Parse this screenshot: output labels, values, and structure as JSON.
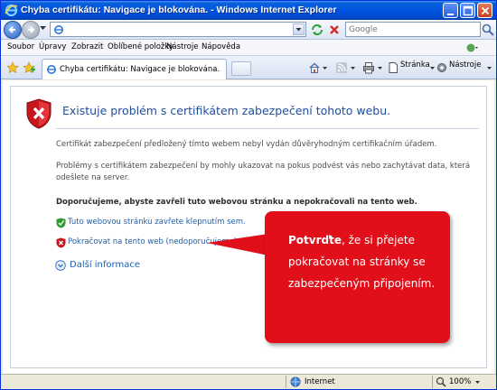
{
  "window": {
    "title": "Chyba certifikátu: Navigace je blokována. - Windows Internet Explorer"
  },
  "addressbar": {
    "url": "",
    "search_placeholder": "Google"
  },
  "menu": {
    "items": [
      "Soubor",
      "Úpravy",
      "Zobrazit",
      "Oblíbené položky",
      "Nástroje",
      "Nápověda"
    ]
  },
  "tabbar": {
    "tab_title": "Chyba certifikátu: Navigace je blokována.",
    "page_label": "Stránka",
    "tools_label": "Nástroje"
  },
  "page": {
    "heading": "Existuje problém s certifikátem zabezpečení tohoto webu.",
    "para1": "Certifikát zabezpečení předložený tímto webem nebyl vydán důvěryhodným certifikačním úřadem.",
    "para2": "Problémy s certifikátem zabezpečení by mohly ukazovat na pokus podvést vás nebo zachytávat data, která odešlete na server.",
    "recommend": "Doporučujeme, abyste zavřeli tuto webovou stránku a nepokračovali na tento web.",
    "link_close": "Tuto webovou stránku zavřete klepnutím sem.",
    "link_continue": "Pokračovat na tento web (nedoporučujeme)",
    "more_info": "Další informace"
  },
  "callout": {
    "bold": "Potvrďte",
    "text": ", že si přejete pokračovat na stránky se zabezpečeným připojením."
  },
  "statusbar": {
    "zone": "Internet",
    "zoom": "100%"
  },
  "colors": {
    "title_bar": "#0055e5",
    "callout": "#e10f1a",
    "link": "#1e5fad",
    "heading": "#1f4e9c"
  }
}
